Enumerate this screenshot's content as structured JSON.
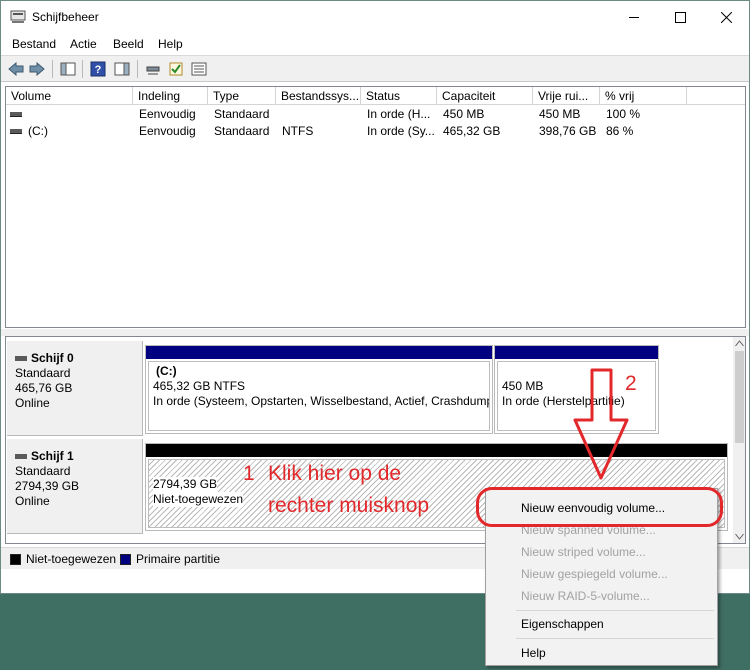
{
  "window": {
    "title": "Schijfbeheer",
    "controls": {
      "minimize": "—",
      "maximize": "☐",
      "close": "✕"
    }
  },
  "menu": [
    "Bestand",
    "Actie",
    "Beeld",
    "Help"
  ],
  "toolbar": {
    "icons": [
      "back-icon",
      "forward-icon",
      "console-tree-icon",
      "help-icon",
      "action-pane-icon",
      "connect-icon",
      "check-icon",
      "properties-icon"
    ]
  },
  "list": {
    "columns": [
      "Volume",
      "Indeling",
      "Type",
      "Bestandssys...",
      "Status",
      "Capaciteit",
      "Vrije rui...",
      "% vrij"
    ],
    "rows": [
      {
        "volume": "",
        "indeling": "Eenvoudig",
        "type": "Standaard",
        "fs": "",
        "status": "In orde (H...",
        "capaciteit": "450 MB",
        "vrij": "450 MB",
        "pct": "100 %"
      },
      {
        "volume": "(C:)",
        "indeling": "Eenvoudig",
        "type": "Standaard",
        "fs": "NTFS",
        "status": "In orde (Sy...",
        "capaciteit": "465,32 GB",
        "vrij": "398,76 GB",
        "pct": "86 %"
      }
    ]
  },
  "disks": [
    {
      "name": "Schijf 0",
      "type": "Standaard",
      "size": "465,76 GB",
      "state": "Online",
      "partitions": [
        {
          "title": "(C:)",
          "line1": "465,32 GB NTFS",
          "line2": "In orde (Systeem, Opstarten, Wisselbestand, Actief, Crashdump, Primaire partitie)"
        },
        {
          "title": "",
          "line1": "450 MB",
          "line2": "In orde (Herstelpartitie)"
        }
      ]
    },
    {
      "name": "Schijf 1",
      "type": "Standaard",
      "size": "2794,39 GB",
      "state": "Online",
      "partitions": [
        {
          "title": "",
          "line1": "2794,39 GB",
          "line2": "Niet-toegewezen"
        }
      ]
    }
  ],
  "legend": [
    {
      "label": "Niet-toegewezen",
      "color": "#000000"
    },
    {
      "label": "Primaire partitie",
      "color": "#000080"
    }
  ],
  "context_menu": {
    "items": [
      {
        "label": "Nieuw eenvoudig volume...",
        "enabled": true
      },
      {
        "label": "Nieuw spanned volume...",
        "enabled": false
      },
      {
        "label": "Nieuw striped volume...",
        "enabled": false
      },
      {
        "label": "Nieuw gespiegeld volume...",
        "enabled": false
      },
      {
        "label": "Nieuw RAID-5-volume...",
        "enabled": false
      },
      {
        "label": "Eigenschappen",
        "enabled": true
      },
      {
        "label": "Help",
        "enabled": true
      }
    ]
  },
  "annotations": {
    "step1_number": "1",
    "step1_line1": "Klik hier op de",
    "step1_line2": "rechter muisknop",
    "step2_number": "2",
    "color": "#e2282a"
  },
  "colors": {
    "primary_partition": "#000080",
    "unallocated": "#000000"
  }
}
